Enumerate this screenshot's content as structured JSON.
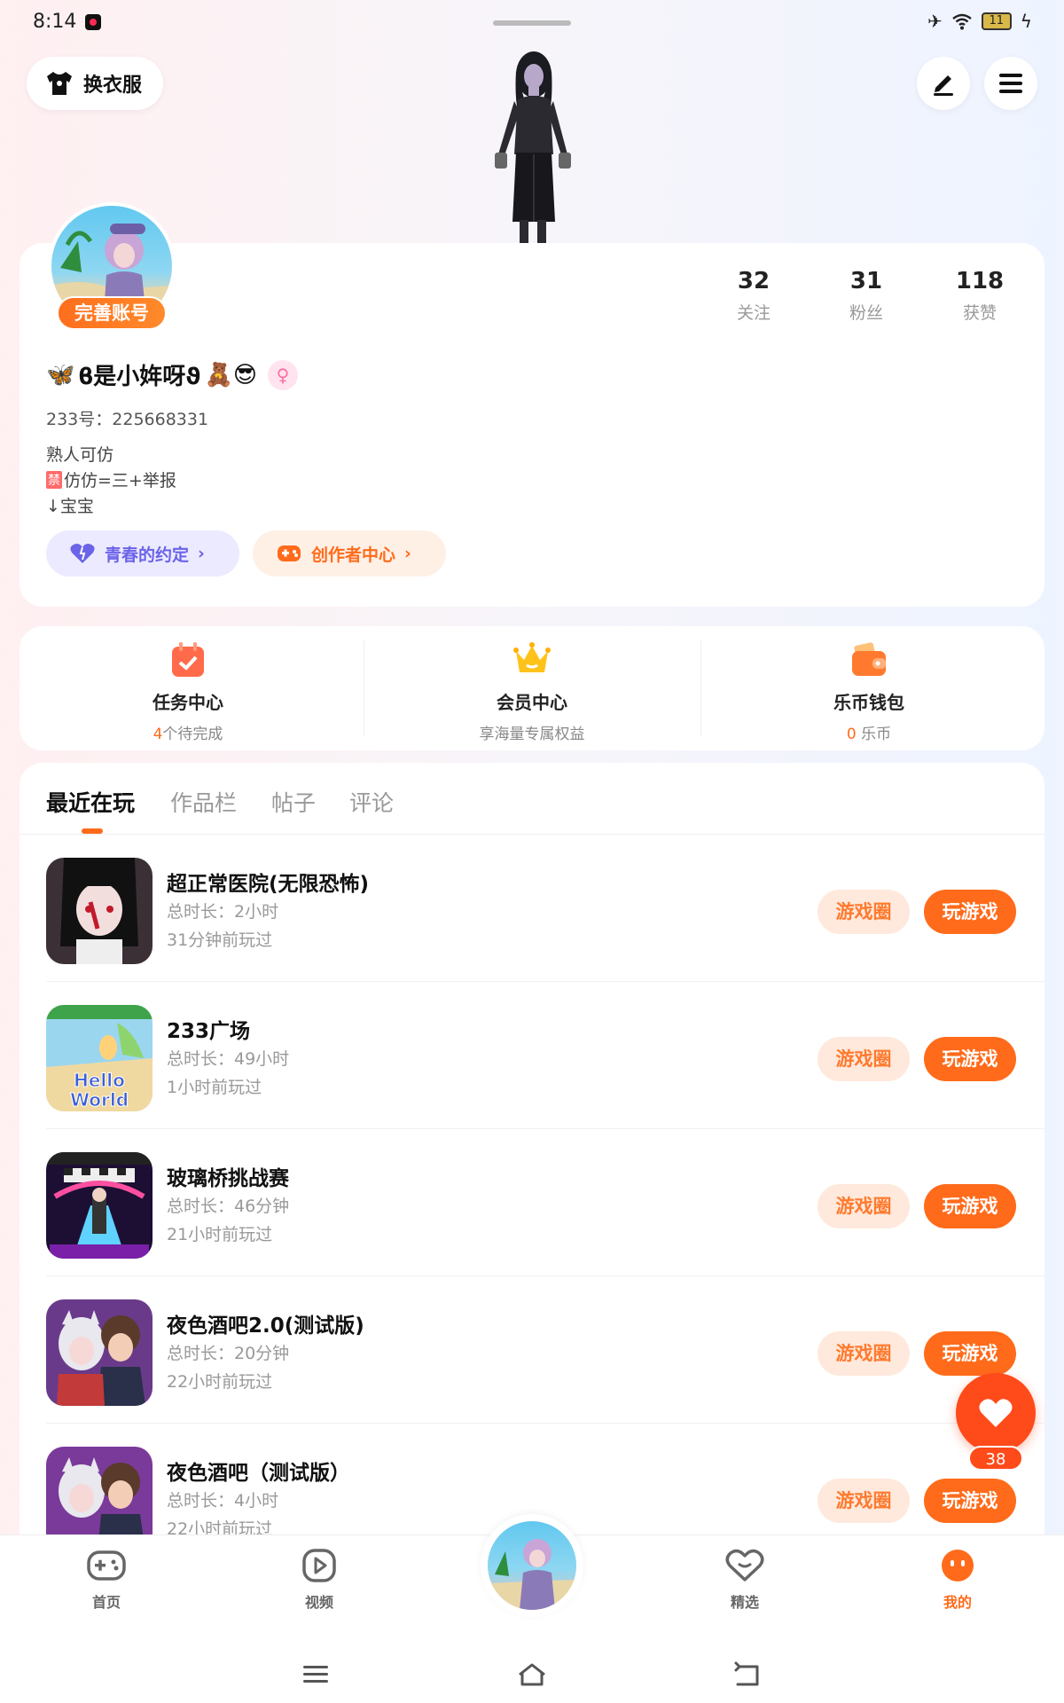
{
  "status_bar": {
    "time": "8:14",
    "battery": "11"
  },
  "header": {
    "outfit_label": "换衣服"
  },
  "profile": {
    "complete_badge": "完善账号",
    "stats": [
      {
        "num": "32",
        "label": "关注"
      },
      {
        "num": "31",
        "label": "粉丝"
      },
      {
        "num": "118",
        "label": "获赞"
      }
    ],
    "nickname_prefix": "🦋",
    "nickname_core": "ϐ是小姩呀ϑ",
    "nickname_suffix": "🧸😎",
    "uid": "233号：225668331",
    "bio": [
      "熟人可仿",
      "仿仿=三+举报",
      "↓宝宝"
    ],
    "bio_tag": "禁",
    "youth_label": "青春的约定",
    "creator_label": "创作者中心"
  },
  "services": [
    {
      "title": "任务中心",
      "highlight": "4",
      "sub": "个待完成"
    },
    {
      "title": "会员中心",
      "highlight": "",
      "sub": "享海量专属权益"
    },
    {
      "title": "乐币钱包",
      "highlight": "0",
      "sub": "乐币"
    }
  ],
  "tabs": [
    "最近在玩",
    "作品栏",
    "帖子",
    "评论"
  ],
  "games": [
    {
      "title": "超正常医院(无限恐怖)",
      "duration": "总时长：2小时",
      "last": "31分钟前玩过"
    },
    {
      "title": "233广场",
      "duration": "总时长：49小时",
      "last": "1小时前玩过"
    },
    {
      "title": "玻璃桥挑战赛",
      "duration": "总时长：46分钟",
      "last": "21小时前玩过"
    },
    {
      "title": "夜色酒吧2.0(测试版)",
      "duration": "总时长：20分钟",
      "last": "22小时前玩过"
    },
    {
      "title": "夜色酒吧（测试版）",
      "duration": "总时长：4小时",
      "last": "22小时前玩过"
    }
  ],
  "game_buttons": {
    "circle": "游戏圈",
    "play": "玩游戏"
  },
  "game_icon_text": {
    "hello_world": "Hello World",
    "glass_bridge": "玻璃桥挑战赛"
  },
  "like_count": "38",
  "bottom_nav": [
    {
      "label": "首页"
    },
    {
      "label": "视频"
    },
    {
      "label": "精选"
    },
    {
      "label": "我的"
    }
  ],
  "colors": {
    "accent": "#ff6b1a",
    "youth": "#6b63e8",
    "like": "#ff4a1a"
  }
}
